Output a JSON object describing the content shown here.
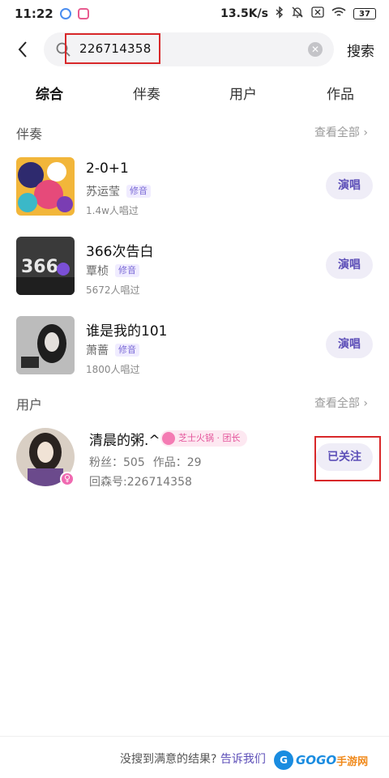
{
  "status_bar": {
    "time": "11:22",
    "net_speed": "13.5K/s",
    "battery": "37",
    "icons": [
      "bluetooth-icon",
      "mute-icon",
      "sim-icon",
      "wifi-icon",
      "battery-icon"
    ]
  },
  "search": {
    "query": "226714358",
    "submit_label": "搜索"
  },
  "tabs": [
    {
      "label": "综合",
      "active": true
    },
    {
      "label": "伴奏",
      "active": false
    },
    {
      "label": "用户",
      "active": false
    },
    {
      "label": "作品",
      "active": false
    }
  ],
  "accompaniment_section": {
    "title": "伴奏",
    "see_all": "查看全部"
  },
  "songs": [
    {
      "title": "2-0+1",
      "artist": "苏运莹",
      "tag": "修音",
      "count": "1.4w人唱过",
      "action": "演唱"
    },
    {
      "title": "366次告白",
      "artist": "覃桢",
      "tag": "修音",
      "count": "5672人唱过",
      "action": "演唱"
    },
    {
      "title": "谁是我的101",
      "artist": "萧蔷",
      "tag": "修音",
      "count": "1800人唱过",
      "action": "演唱"
    }
  ],
  "user_section": {
    "title": "用户",
    "see_all": "查看全部"
  },
  "user": {
    "name": "清晨的粥.^",
    "badge": "芝士火锅 · 团长",
    "fans": "粉丝：505",
    "works": "作品：29",
    "id": "回森号:226714358",
    "follow_label": "已关注",
    "gender_symbol": "♀"
  },
  "footer": {
    "prompt": "没搜到满意的结果? ",
    "link": "告诉我们"
  },
  "watermark": {
    "badge": "G",
    "text": "GOGO",
    "text2": "手游网"
  },
  "colors": {
    "accent": "#5d4fb8",
    "button_bg": "#efedf7",
    "tab_underline": "#ffe45c",
    "highlight_box": "#d8282a",
    "badge_pink": "#e4559b"
  }
}
